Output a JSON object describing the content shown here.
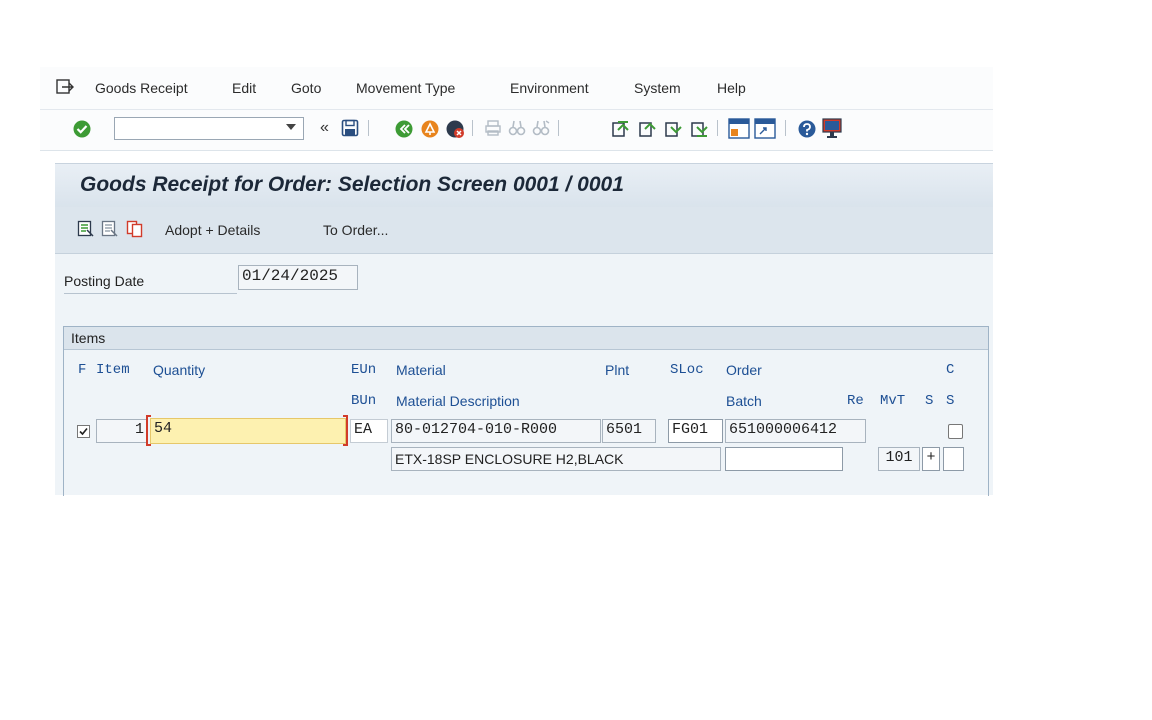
{
  "menu": {
    "items": [
      "Goods Receipt",
      "Edit",
      "Goto",
      "Movement Type",
      "Environment",
      "System",
      "Help"
    ]
  },
  "toolbar": {
    "command_value": "",
    "back_glyph": "«"
  },
  "screen": {
    "title": "Goods Receipt for Order: Selection Screen 0001 / 0001"
  },
  "app_toolbar": {
    "adopt_details": "Adopt + Details",
    "to_order": "To Order..."
  },
  "header": {
    "posting_date_label": "Posting Date",
    "posting_date_value": "01/24/2025"
  },
  "items": {
    "group_title": "Items",
    "columns_row1": {
      "f": "F",
      "item": "Item",
      "quantity": "Quantity",
      "eun": "EUn",
      "material": "Material",
      "plnt": "Plnt",
      "sloc": "SLoc",
      "order": "Order",
      "c": "C"
    },
    "columns_row2": {
      "bun": "BUn",
      "material_description": "Material Description",
      "batch": "Batch",
      "re": "Re",
      "mvt": "MvT",
      "s1": "S",
      "s2": "S"
    },
    "row": {
      "selected": true,
      "item": "1",
      "quantity": "54",
      "eun": "EA",
      "material": "80-012704-010-R000",
      "plant": "6501",
      "sloc": "FG01",
      "order": "651000006412",
      "material_description": "ETX-18SP ENCLOSURE H2,BLACK",
      "batch": "",
      "mvt": "101",
      "s": "+",
      "s2": ""
    }
  },
  "colors": {
    "accent_green": "#3d9b35",
    "orange": "#e8841d",
    "red": "#d13b2a",
    "quantity_highlight": "#fdf1b0",
    "column_header_blue": "#1d4f94"
  }
}
